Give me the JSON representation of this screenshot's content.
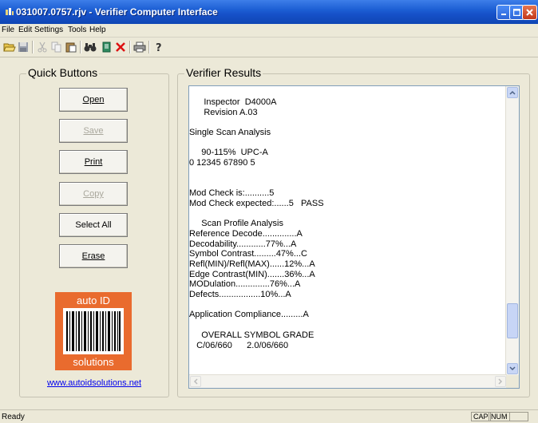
{
  "window": {
    "title": "031007.0757.rjv - Verifier Computer Interface"
  },
  "menu": [
    "File",
    "Edit",
    "Settings",
    "Tools",
    "Help"
  ],
  "toolbar_icons": [
    "open-icon",
    "save-icon",
    "cut-icon",
    "copy-icon",
    "paste-icon",
    "find-icon",
    "document-icon",
    "delete-icon",
    "print-icon",
    "help-icon"
  ],
  "quick_buttons": {
    "title": "Quick Buttons",
    "open": "Open",
    "save": "Save",
    "print": "Print",
    "copy": "Copy",
    "select_all": "Select All",
    "erase": "Erase"
  },
  "logo": {
    "top": "auto ID",
    "bottom": "solutions"
  },
  "link": "www.autoidsolutions.net",
  "results": {
    "title": "Verifier Results",
    "lines": [
      "      Inspector  D4000A",
      "      Revision A.03",
      "",
      "Single Scan Analysis",
      "",
      "     90-115%  UPC-A",
      "0 12345 67890 5",
      "",
      "",
      "Mod Check is:..........5",
      "Mod Check expected:......5   PASS",
      "",
      "     Scan Profile Analysis",
      "Reference Decode..............A",
      "Decodability............77%...A",
      "Symbol Contrast.........47%...C",
      "Refl(MIN)/Refl(MAX)......12%...A",
      "Edge Contrast(MIN).......36%...A",
      "MODulation..............76%...A",
      "Defects.................10%...A",
      "",
      "Application Compliance.........A",
      "",
      "     OVERALL SYMBOL GRADE",
      "   C/06/660      2.0/06/660"
    ]
  },
  "status": {
    "text": "Ready",
    "cap": "CAP",
    "num": "NUM"
  }
}
